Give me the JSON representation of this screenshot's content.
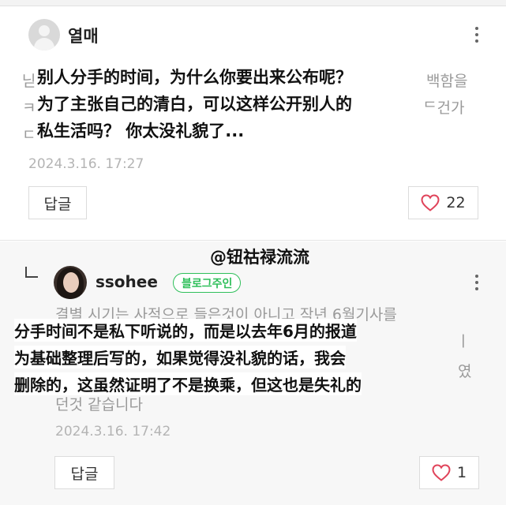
{
  "comment1": {
    "username": "열매",
    "bg_fragments": [
      "닏",
      "ㅋ",
      "ㄷ",
      "백함을",
      "ᄃ건가"
    ],
    "caption": [
      "别人分手的时间，为什么你要出来公布呢？",
      "为了主张自己的清白，可以这样公开别人的",
      "私生活吗？ 你太没礼貌了..."
    ],
    "timestamp": "2024.3.16. 17:27",
    "reply_label": "답글",
    "like_count": "22"
  },
  "watermark": "@钮祜禄流流",
  "comment2": {
    "username": "ssohee",
    "badge": "블로그주인",
    "bg_lines": [
      "결별 시기는 사적으로 들은것이 아니고 작년 6월기사를",
      "ㅣ",
      "였",
      "던것 같습니다"
    ],
    "caption": [
      "分手时间不是私下听说的，而是以去年6月的报道",
      "为基础整理后写的，如果觉得没礼貌的话，我会",
      "删除的，这虽然证明了不是换乘，但这也是失礼的"
    ],
    "timestamp": "2024.3.16. 17:42",
    "reply_label": "답글",
    "like_count": "1"
  },
  "colors": {
    "accent_green": "#2fbf5a",
    "heart": "#e0435a",
    "timestamp": "#b4b4b4"
  },
  "icons": [
    "profile-placeholder-icon",
    "more-vertical-icon",
    "heart-outline-icon",
    "reply-arrow-icon"
  ]
}
